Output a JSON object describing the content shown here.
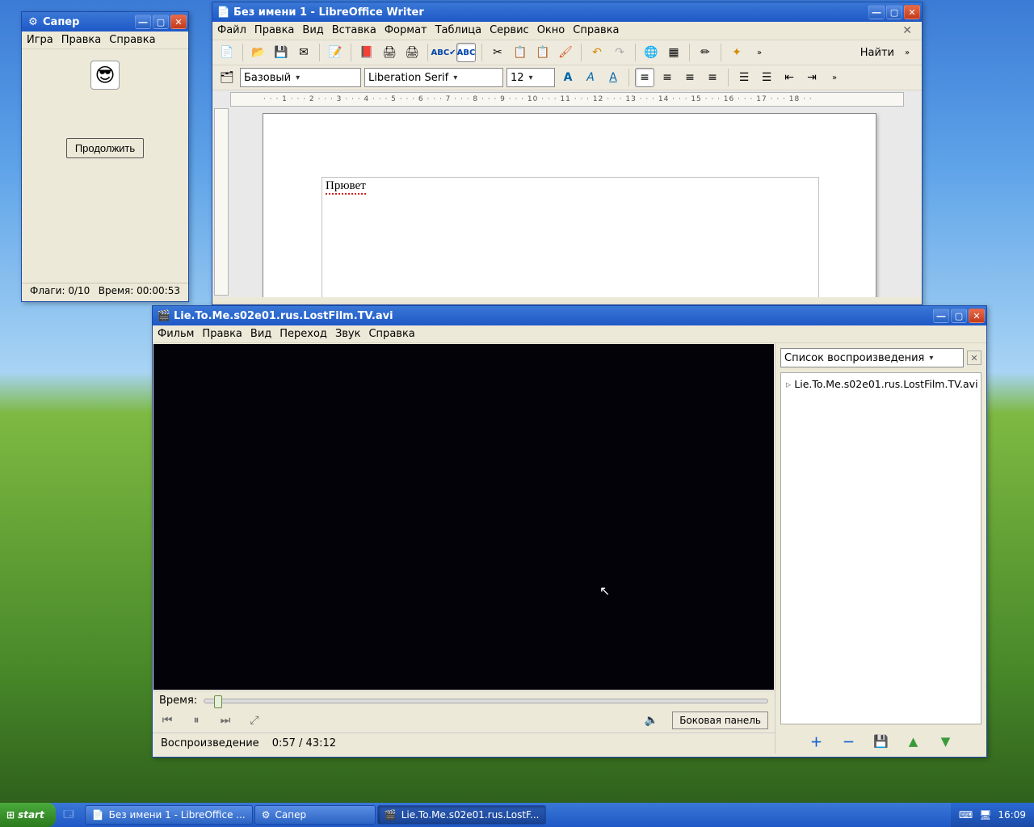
{
  "saper": {
    "title": "Сапер",
    "menu": [
      "Игра",
      "Правка",
      "Справка"
    ],
    "continue_btn": "Продолжить",
    "flags_label": "Флаги: 0/10",
    "time_label": "Время: 00:00:53",
    "face_emoji": "😎"
  },
  "writer": {
    "title": "Без имени 1 - LibreOffice Writer",
    "menu": [
      "Файл",
      "Правка",
      "Вид",
      "Вставка",
      "Формат",
      "Таблица",
      "Сервис",
      "Окно",
      "Справка"
    ],
    "find_label": "Найти",
    "style_combo": "Базовый",
    "font_combo": "Liberation Serif",
    "size_combo": "12",
    "ruler_text": "· · · 1 · · · 2 · · · 3 · · · 4 · · · 5 · · · 6 · · · 7 · · · 8 · · · 9 · · · 10 · · · 11 · · · 12 · · · 13 · · · 14 · · · 15 · · · 16 · · · 17 · · · 18 · ·",
    "document_text": "Прювет"
  },
  "player": {
    "title": "Lie.To.Me.s02e01.rus.LostFilm.TV.avi",
    "menu": [
      "Фильм",
      "Правка",
      "Вид",
      "Переход",
      "Звук",
      "Справка"
    ],
    "time_label": "Время:",
    "side_panel_btn": "Боковая панель",
    "status_state": "Воспроизведение",
    "status_time": "0:57 / 43:12",
    "playlist_header": "Список воспроизведения",
    "playlist_items": [
      "Lie.To.Me.s02e01.rus.LostFilm.TV.avi"
    ]
  },
  "taskbar": {
    "start": "start",
    "tasks": [
      {
        "label": "Без имени 1 - LibreOffice ...",
        "active": false
      },
      {
        "label": "Сапер",
        "active": false
      },
      {
        "label": "Lie.To.Me.s02e01.rus.LostF...",
        "active": true
      }
    ],
    "clock": "16:09"
  }
}
